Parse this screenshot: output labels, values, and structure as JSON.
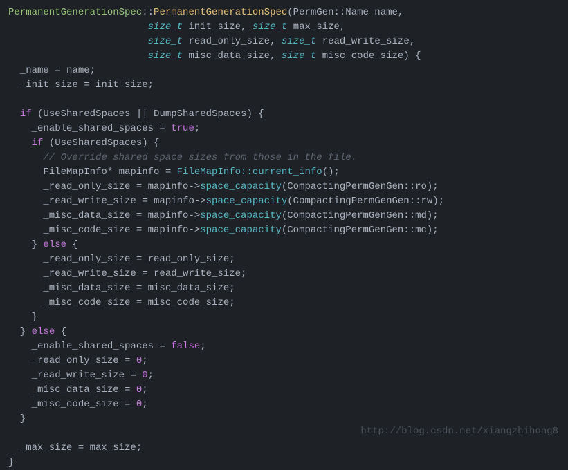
{
  "code": {
    "l1_class": "PermanentGenerationSpec",
    "l1_sep": "::",
    "l1_ctor": "PermanentGenerationSpec",
    "l1_rest": "(PermGen::Name name,",
    "l2_t1": "size_t",
    "l2_a": " init_size, ",
    "l2_t2": "size_t",
    "l2_b": " max_size,",
    "l3_t1": "size_t",
    "l3_a": " read_only_size, ",
    "l3_t2": "size_t",
    "l3_b": " read_write_size,",
    "l4_t1": "size_t",
    "l4_a": " misc_data_size, ",
    "l4_t2": "size_t",
    "l4_b": " misc_code_size) {",
    "l5": "  _name = name;",
    "l6": "  _init_size = init_size;",
    "l7": "",
    "l8_a": "  ",
    "l8_if": "if",
    "l8_b": " (UseSharedSpaces || DumpSharedSpaces) {",
    "l9_a": "    _enable_shared_spaces = ",
    "l9_true": "true",
    "l9_b": ";",
    "l10_a": "    ",
    "l10_if": "if",
    "l10_b": " (UseSharedSpaces) {",
    "l11": "      // Override shared space sizes from those in the file.",
    "l12_a": "      FileMapInfo* mapinfo = ",
    "l12_call": "FileMapInfo::current_info",
    "l12_b": "();",
    "l13_a": "      _read_only_size = mapinfo->",
    "l13_call": "space_capacity",
    "l13_b": "(CompactingPermGenGen::ro);",
    "l14_a": "      _read_write_size = mapinfo->",
    "l14_call": "space_capacity",
    "l14_b": "(CompactingPermGenGen::rw);",
    "l15_a": "      _misc_data_size = mapinfo->",
    "l15_call": "space_capacity",
    "l15_b": "(CompactingPermGenGen::md);",
    "l16_a": "      _misc_code_size = mapinfo->",
    "l16_call": "space_capacity",
    "l16_b": "(CompactingPermGenGen::mc);",
    "l17_a": "    } ",
    "l17_else": "else",
    "l17_b": " {",
    "l18": "      _read_only_size = read_only_size;",
    "l19": "      _read_write_size = read_write_size;",
    "l20": "      _misc_data_size = misc_data_size;",
    "l21": "      _misc_code_size = misc_code_size;",
    "l22": "    }",
    "l23_a": "  } ",
    "l23_else": "else",
    "l23_b": " {",
    "l24_a": "    _enable_shared_spaces = ",
    "l24_false": "false",
    "l24_b": ";",
    "l25_a": "    _read_only_size = ",
    "l25_n": "0",
    "l25_b": ";",
    "l26_a": "    _read_write_size = ",
    "l26_n": "0",
    "l26_b": ";",
    "l27_a": "    _misc_data_size = ",
    "l27_n": "0",
    "l27_b": ";",
    "l28_a": "    _misc_code_size = ",
    "l28_n": "0",
    "l28_b": ";",
    "l29": "  }",
    "l30": "",
    "l31": "  _max_size = max_size;",
    "l32": "}"
  },
  "indent": {
    "sig": "                        "
  },
  "watermark": "http://blog.csdn.net/xiangzhihong8"
}
